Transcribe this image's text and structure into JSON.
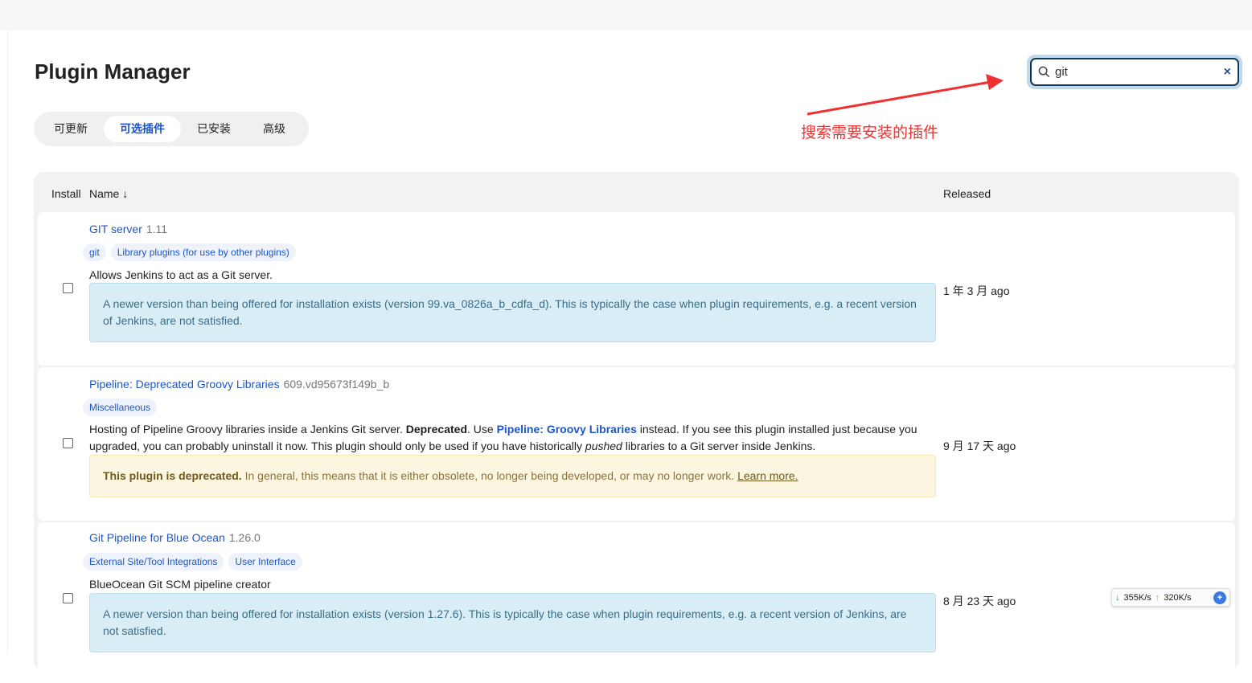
{
  "page": {
    "title": "Plugin Manager"
  },
  "tabs": [
    {
      "label": "可更新"
    },
    {
      "label": "可选插件"
    },
    {
      "label": "已安装"
    },
    {
      "label": "高级"
    }
  ],
  "search": {
    "value": "git",
    "clear": "×"
  },
  "annotation": "搜索需要安装的插件",
  "table": {
    "col_install": "Install",
    "col_name": "Name ↓",
    "col_released": "Released"
  },
  "plugins": [
    {
      "name": "GIT server",
      "version": "1.11",
      "labels": [
        "git",
        "Library plugins (for use by other plugins)"
      ],
      "description": "Allows Jenkins to act as a Git server.",
      "note": "A newer version than being offered for installation exists (version 99.va_0826a_b_cdfa_d). This is typically the case when plugin requirements, e.g. a recent version of Jenkins, are not satisfied.",
      "released": "1 年 3 月 ago"
    },
    {
      "name": "Pipeline: Deprecated Groovy Libraries",
      "version": "609.vd95673f149b_b",
      "labels": [
        "Miscellaneous"
      ],
      "desc_a": "Hosting of Pipeline Groovy libraries inside a Jenkins Git server. ",
      "desc_b": "Deprecated",
      "desc_c": ". Use ",
      "desc_link": "Pipeline: Groovy Libraries",
      "desc_d": " instead. If you see this plugin installed just because you upgraded, you can probably uninstall it now. This plugin should only be used if you have historically ",
      "desc_em": "pushed",
      "desc_e": " libraries to a Git server inside Jenkins.",
      "warn_bold": "This plugin is deprecated.",
      "warn_text": " In general, this means that it is either obsolete, no longer being developed, or may no longer work. ",
      "warn_link": "Learn more.",
      "released": "9 月 17 天 ago"
    },
    {
      "name": "Git Pipeline for Blue Ocean",
      "version": "1.26.0",
      "labels": [
        "External Site/Tool Integrations",
        "User Interface"
      ],
      "description": "BlueOcean Git SCM pipeline creator",
      "note": "A newer version than being offered for installation exists (version 1.27.6). This is typically the case when plugin requirements, e.g. a recent version of Jenkins, are not satisfied.",
      "released": "8 月 23 天 ago"
    }
  ],
  "speed": {
    "down": "355K/s",
    "up": "320K/s"
  }
}
